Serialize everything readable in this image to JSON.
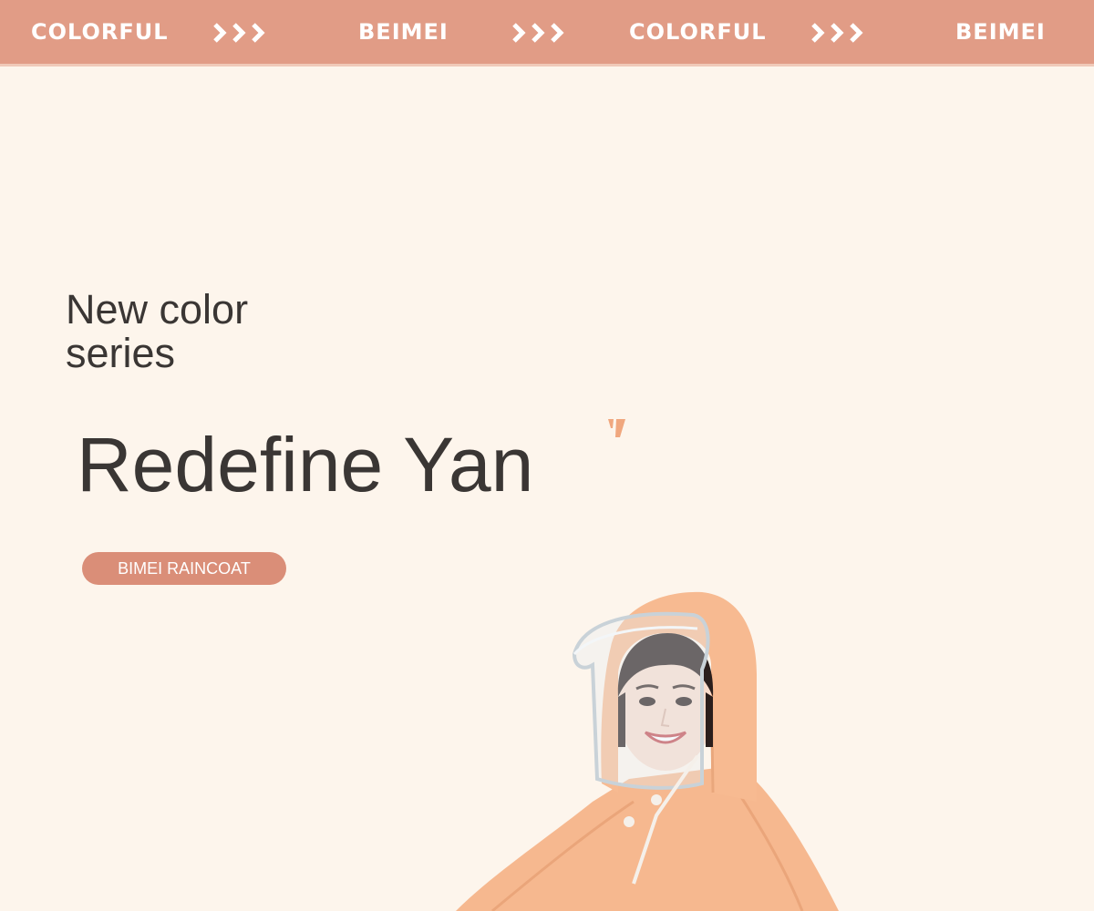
{
  "banner": {
    "words": [
      "COLORFUL",
      "BEIMEI",
      "COLORFUL",
      "BEIMEI"
    ],
    "chevron_icon": "triple-chevron-right-icon",
    "color": "#e19c86",
    "text_color": "#ffffff"
  },
  "hero": {
    "subtitle": "New color series",
    "title": "Redefine Yan",
    "badge": "BIMEI RAINCOAT",
    "badge_color": "#da8e78",
    "text_color": "#3a3634",
    "background": "#fdf5ec"
  },
  "product": {
    "image_subject": "model wearing apricot hooded raincoat with clear visor",
    "coat_color": "#f6b88f"
  }
}
